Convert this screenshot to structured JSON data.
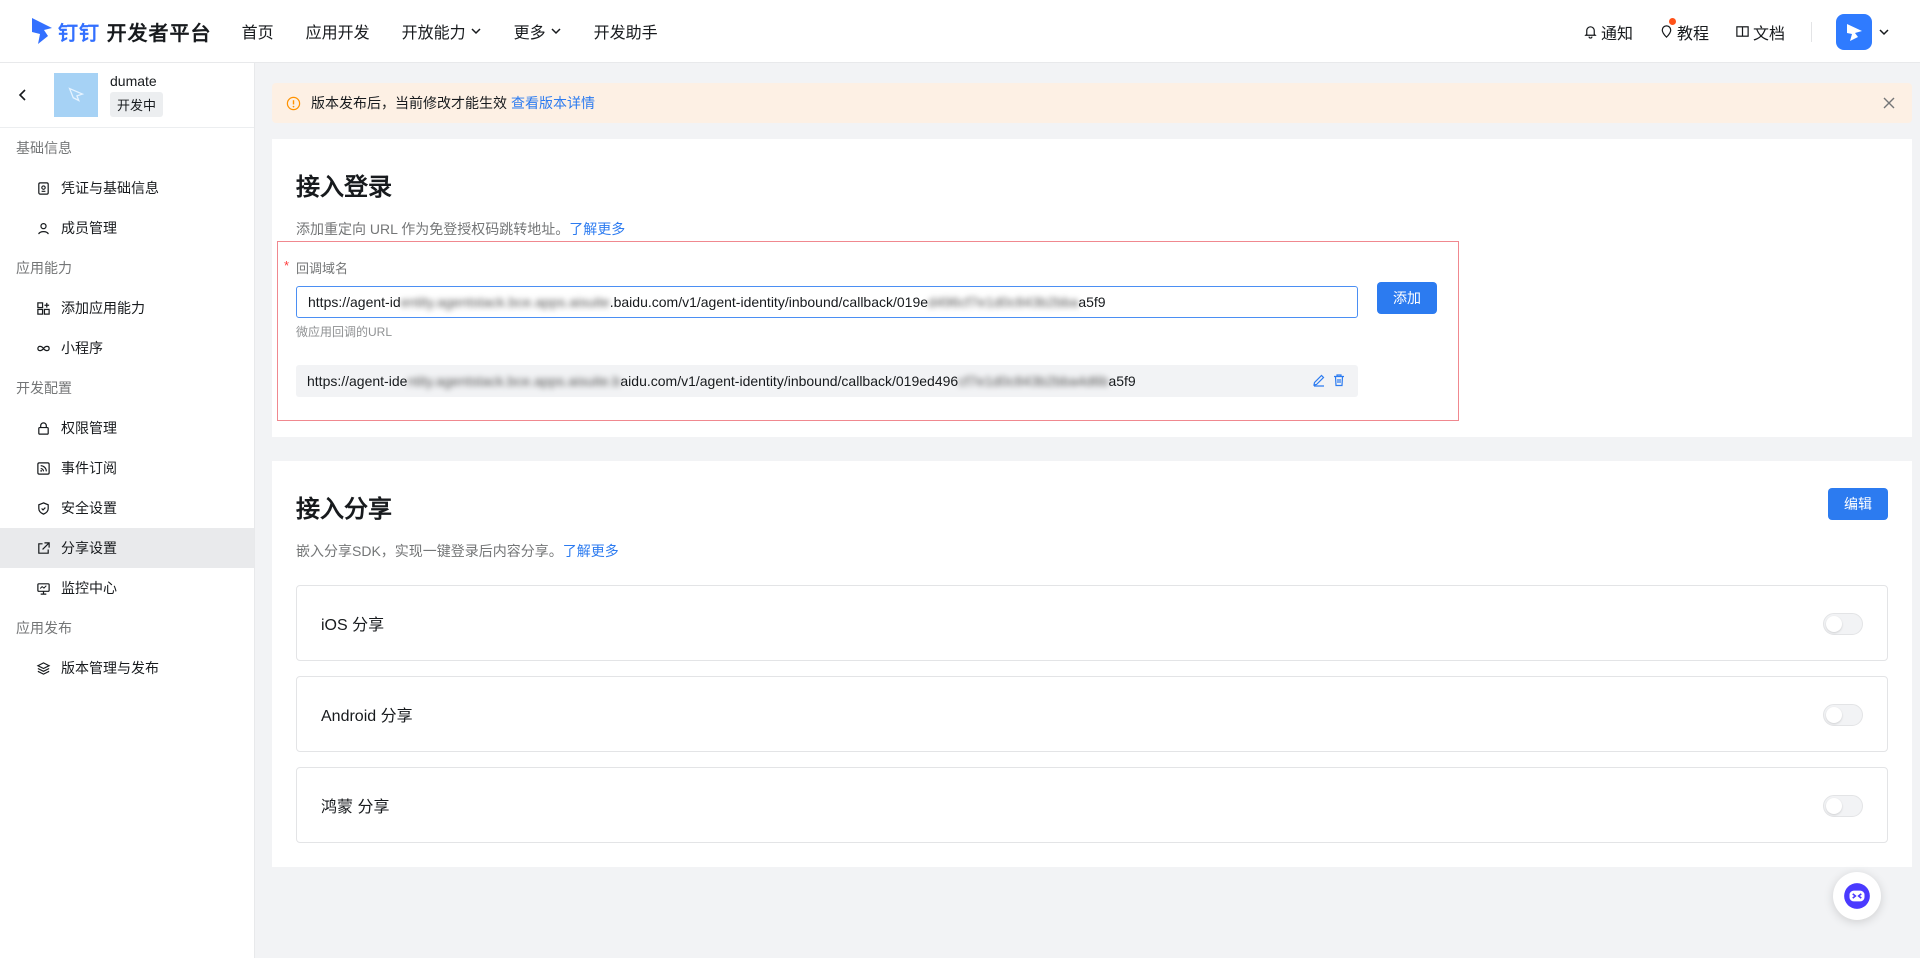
{
  "topnav": {
    "logo_brand": "钉钉",
    "logo_text": "开发者平台",
    "items": [
      {
        "label": "首页"
      },
      {
        "label": "应用开发"
      },
      {
        "label": "开放能力"
      },
      {
        "label": "更多"
      },
      {
        "label": "开发助手"
      }
    ],
    "right": {
      "notify": "通知",
      "tutorial": "教程",
      "docs": "文档"
    }
  },
  "sidebar": {
    "app_name": "dumate",
    "app_status": "开发中",
    "groups": [
      {
        "title": "基础信息",
        "items": [
          {
            "label": "凭证与基础信息"
          },
          {
            "label": "成员管理"
          }
        ]
      },
      {
        "title": "应用能力",
        "items": [
          {
            "label": "添加应用能力"
          },
          {
            "label": "小程序"
          }
        ]
      },
      {
        "title": "开发配置",
        "items": [
          {
            "label": "权限管理"
          },
          {
            "label": "事件订阅"
          },
          {
            "label": "安全设置"
          },
          {
            "label": "分享设置"
          },
          {
            "label": "监控中心"
          }
        ]
      },
      {
        "title": "应用发布",
        "items": [
          {
            "label": "版本管理与发布"
          }
        ]
      }
    ]
  },
  "notice": {
    "text": "版本发布后，当前修改才能生效",
    "link": "查看版本详情"
  },
  "login": {
    "title": "接入登录",
    "desc": "添加重定向 URL 作为免登授权码跳转地址。",
    "desc_link": "了解更多",
    "field_label": "回调域名",
    "input_value_a": "https://agent-id",
    "input_value_blur": "entity.agentstack.bce.apps.aisuite",
    "input_value_b": ".baidu.com/v1/agent-identity/inbound/callback/019e",
    "input_value_blur2": "d496cf7e1d0c843b2bba",
    "input_value_c": "a5f9",
    "field_hint": "微应用回调的URL",
    "add_button": "添加",
    "saved_a": "https://agent-ide",
    "saved_blur": "ntity.agentstack.bce.apps.aisuite.b",
    "saved_b": "aidu.com/v1/agent-identity/inbound/callback/019ed496",
    "saved_blur2": "cf7e1d0c843b2bba4d6b",
    "saved_c": "a5f9"
  },
  "share": {
    "title": "接入分享",
    "desc": "嵌入分享SDK，实现一键登录后内容分享。",
    "desc_link": "了解更多",
    "edit_button": "编辑",
    "rows": [
      {
        "label": "iOS 分享",
        "enabled": false
      },
      {
        "label": "Android 分享",
        "enabled": false
      },
      {
        "label": "鸿蒙 分享",
        "enabled": false
      }
    ]
  },
  "colors": {
    "primary": "#2c7bf0",
    "notice_bg": "#fdf0e4",
    "highlight_border": "#f0888f"
  }
}
